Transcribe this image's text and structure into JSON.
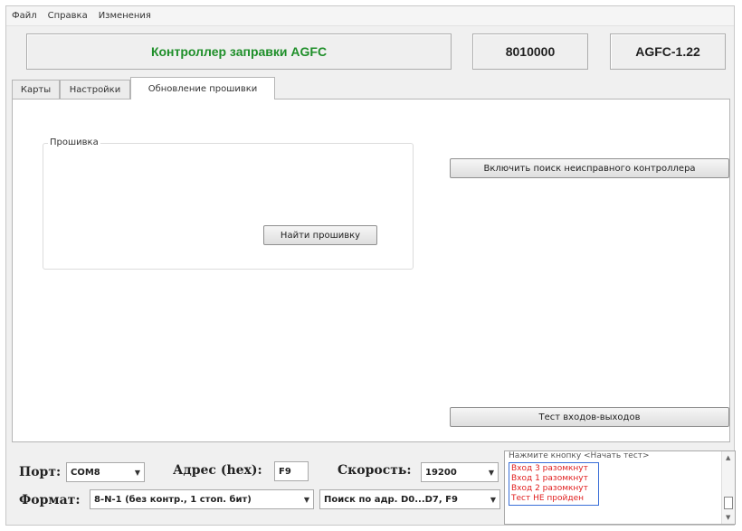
{
  "menu": [
    "Файл",
    "Справка",
    "Изменения"
  ],
  "header": {
    "title": "Контроллер заправки AGFC",
    "serial": "8010000",
    "version": "AGFC-1.22"
  },
  "tabs": [
    {
      "label": "Карты"
    },
    {
      "label": "Настройки"
    },
    {
      "label": "Обновление прошивки"
    }
  ],
  "firmware": {
    "group_title": "Прошивка",
    "find_button": "Найти прошивку"
  },
  "buttons": {
    "faulty_search": "Включить поиск неисправного контроллера",
    "io_test": "Тест входов-выходов"
  },
  "connection": {
    "port_label": "Порт:",
    "port_value": "COM8",
    "addr_label": "Адрес (hex):",
    "addr_value": "F9",
    "speed_label": "Скорость:",
    "speed_value": "19200",
    "format_label": "Формат:",
    "format_value": "8-N-1 (без контр., 1 стоп. бит)",
    "search_value": "Поиск по адр. D0...D7, F9"
  },
  "log": {
    "hint": "Нажмите кнопку <Начать тест>",
    "lines": [
      "Вход 3 разомкнут",
      "Вход 1 разомкнут",
      "Вход 2 разомкнут",
      "Тест НЕ пройден"
    ]
  },
  "colors": {
    "title_green": "#1f8f2a",
    "log_red": "#e02020",
    "log_frame_blue": "#3a6fd8"
  },
  "icons": [
    "dropdown-arrow-icon",
    "scroll-up-icon",
    "scroll-down-icon"
  ]
}
